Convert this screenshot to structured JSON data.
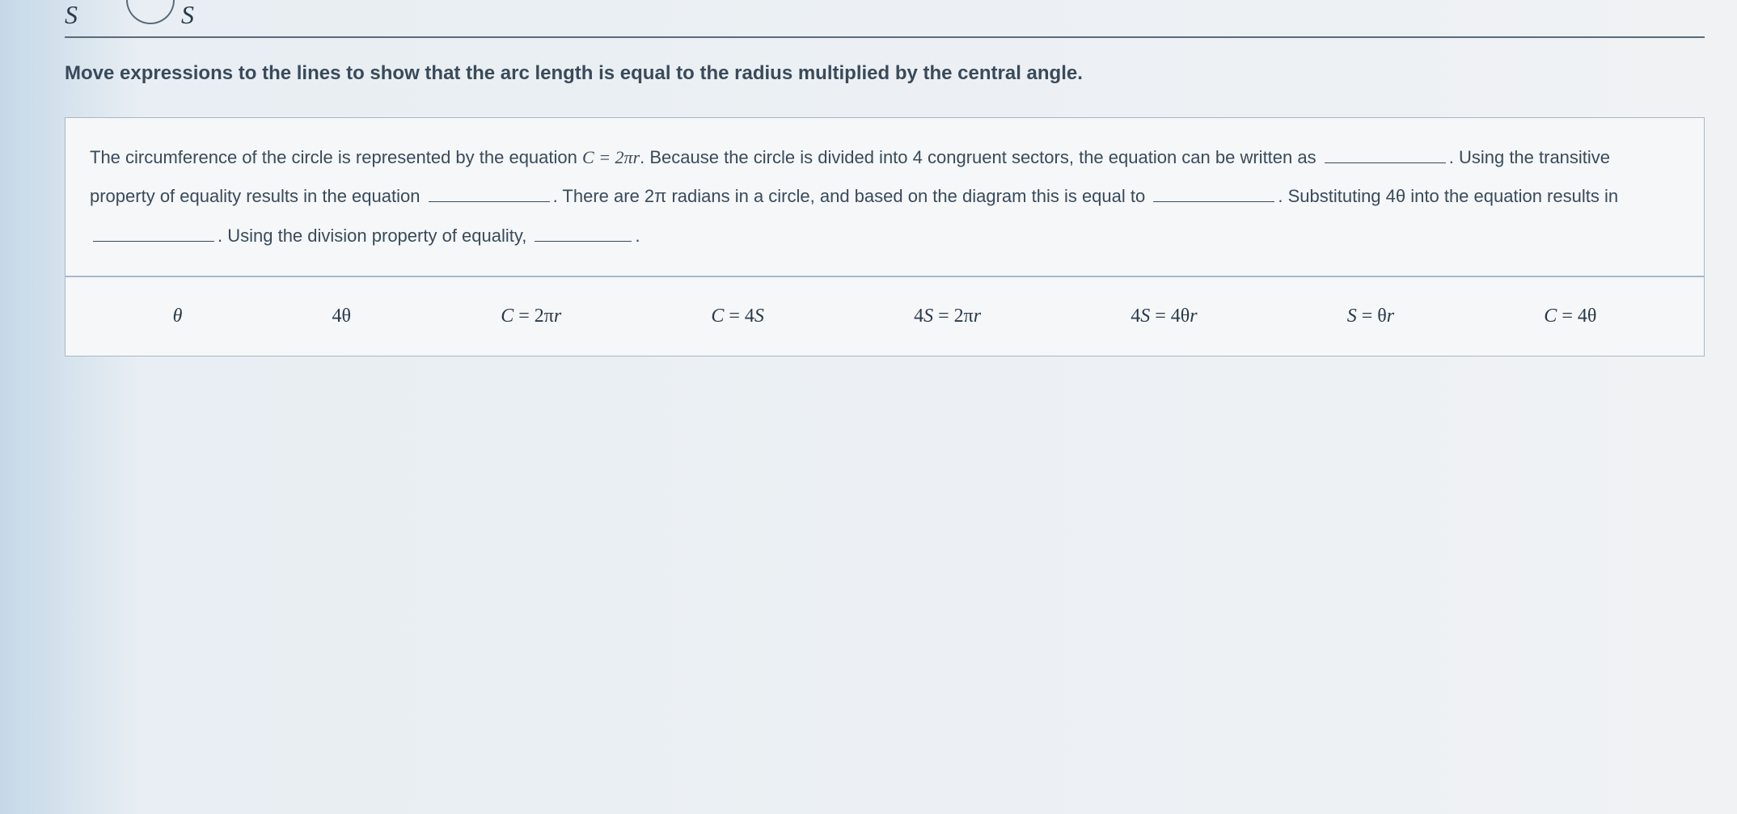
{
  "top": {
    "label_left": "S",
    "label_right": "S"
  },
  "instruction": "Move expressions to the lines to show that the arc length is equal to the radius multiplied by the central angle.",
  "proof": {
    "part1": "The circumference of the circle is represented by the equation ",
    "eq1": "C = 2πr",
    "part2": ". Because the circle is divided into 4 congruent sectors, the equation can be written as ",
    "part3": ". Using the transitive property of equality results in the equation ",
    "part4": ". There are 2π radians in a circle, and based on the diagram this is equal to ",
    "part5": ". Substituting 4θ into the equation results in ",
    "part6": ". Using the division property of equality, ",
    "part7": "."
  },
  "options": {
    "opt1": "θ",
    "opt2": "4θ",
    "opt3": "C = 2πr",
    "opt4": "C = 4S",
    "opt5": "4S = 2πr",
    "opt6": "4S = 4θr",
    "opt7": "S = θr",
    "opt8": "C = 4θ"
  }
}
